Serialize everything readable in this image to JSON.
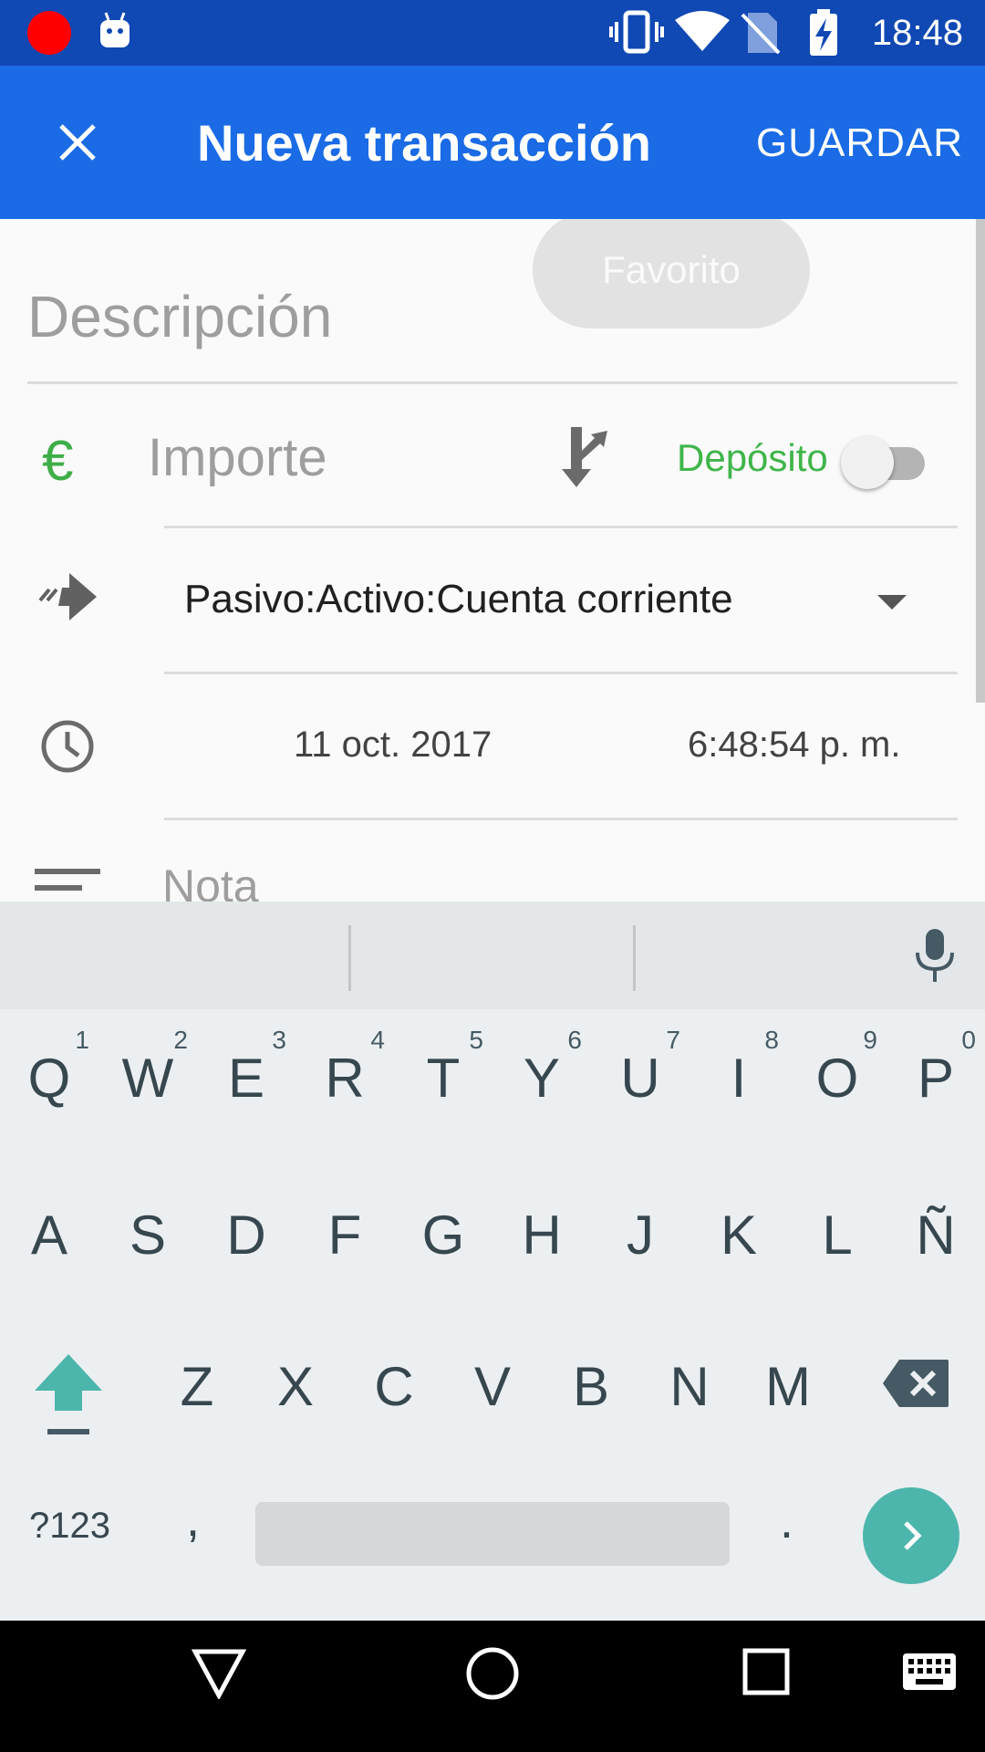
{
  "status_bar": {
    "time": "18:48",
    "icons": [
      "record-dot",
      "android-debug-icon",
      "vibrate-icon",
      "wifi-icon",
      "no-sim-icon",
      "battery-charging-icon"
    ],
    "record_color": "#ff0000"
  },
  "app_bar": {
    "close_icon": "close-icon",
    "title": "Nueva transacción",
    "save_label": "GUARDAR",
    "color": "#1a6be5"
  },
  "form": {
    "favorite_chip": "Favorito",
    "description_placeholder": "Descripción",
    "currency_symbol": "€",
    "amount_placeholder": "Importe",
    "split_icon": "split-icon",
    "deposit_label": "Depósito",
    "deposit_toggle_on": false,
    "account": "Pasivo:Activo:Cuenta corriente",
    "date": "11 oct. 2017",
    "time": "6:48:54 p. m.",
    "note_placeholder": "Nota",
    "accent_color": "#3fb54a"
  },
  "keyboard": {
    "row1": [
      {
        "key": "Q",
        "hint": "1"
      },
      {
        "key": "W",
        "hint": "2"
      },
      {
        "key": "E",
        "hint": "3"
      },
      {
        "key": "R",
        "hint": "4"
      },
      {
        "key": "T",
        "hint": "5"
      },
      {
        "key": "Y",
        "hint": "6"
      },
      {
        "key": "U",
        "hint": "7"
      },
      {
        "key": "I",
        "hint": "8"
      },
      {
        "key": "O",
        "hint": "9"
      },
      {
        "key": "P",
        "hint": "0"
      }
    ],
    "row2": [
      "A",
      "S",
      "D",
      "F",
      "G",
      "H",
      "J",
      "K",
      "L",
      "Ñ"
    ],
    "row3": [
      "Z",
      "X",
      "C",
      "V",
      "B",
      "N",
      "M"
    ],
    "symbols_label": "?123",
    "comma": ",",
    "period": ".",
    "enter_color": "#4db6ac"
  },
  "nav_bar": {
    "icons": [
      "back-icon",
      "home-icon",
      "recents-icon",
      "keyboard-icon"
    ]
  }
}
